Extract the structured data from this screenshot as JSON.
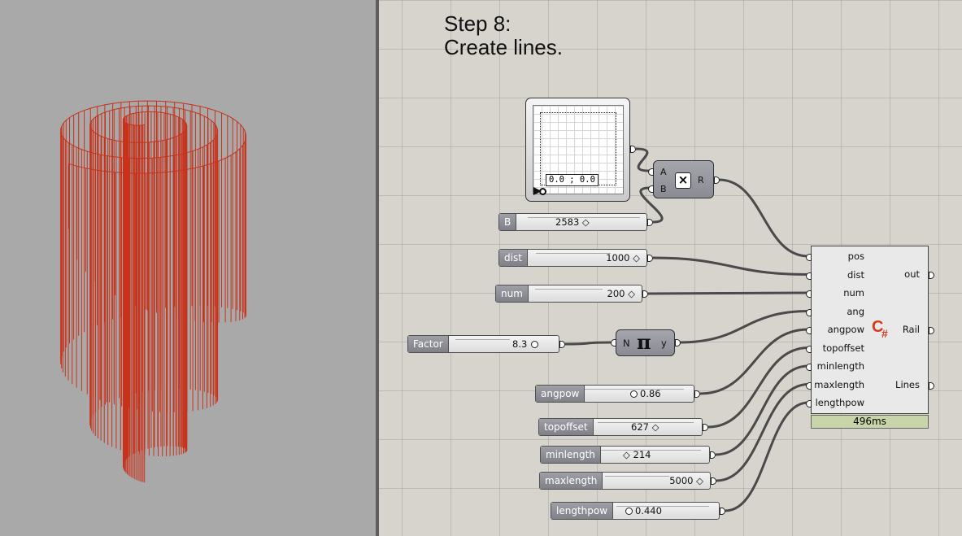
{
  "title": {
    "line1": "Step 8:",
    "line2": "Create lines."
  },
  "graph_mapper": {
    "readout": "0.0 ; 0.0"
  },
  "multiply": {
    "input_a": "A",
    "input_b": "B",
    "output": "R",
    "icon": "multiply-icon"
  },
  "sliders": [
    {
      "id": "B",
      "label": "B",
      "value": "2583 ◇"
    },
    {
      "id": "dist",
      "label": "dist",
      "value": "1000 ◇"
    },
    {
      "id": "num",
      "label": "num",
      "value": "200 ◇"
    },
    {
      "id": "factor",
      "label": "Factor",
      "value": "8.3"
    },
    {
      "id": "angpow",
      "label": "angpow",
      "value": "0.86"
    },
    {
      "id": "topoffset",
      "label": "topoffset",
      "value": "627 ◇"
    },
    {
      "id": "minlength",
      "label": "minlength",
      "value": "◇ 214"
    },
    {
      "id": "maxlength",
      "label": "maxlength",
      "value": "5000 ◇"
    },
    {
      "id": "lengthpow",
      "label": "lengthpow",
      "value": "0.440"
    }
  ],
  "pi": {
    "input": "N",
    "output": "y",
    "symbol": "π"
  },
  "script": {
    "inputs": [
      "pos",
      "dist",
      "num",
      "ang",
      "angpow",
      "topoffset",
      "minlength",
      "maxlength",
      "lengthpow"
    ],
    "outputs": [
      "out",
      "Rail",
      "Lines"
    ],
    "timer": "496ms",
    "icon": "csharp-icon",
    "icon_text": "C#"
  },
  "colors": {
    "geometry": "#c8321b",
    "canvas": "#d6d4cc",
    "viewport": "#a9a9a9",
    "timer": "#c8d5a8"
  }
}
